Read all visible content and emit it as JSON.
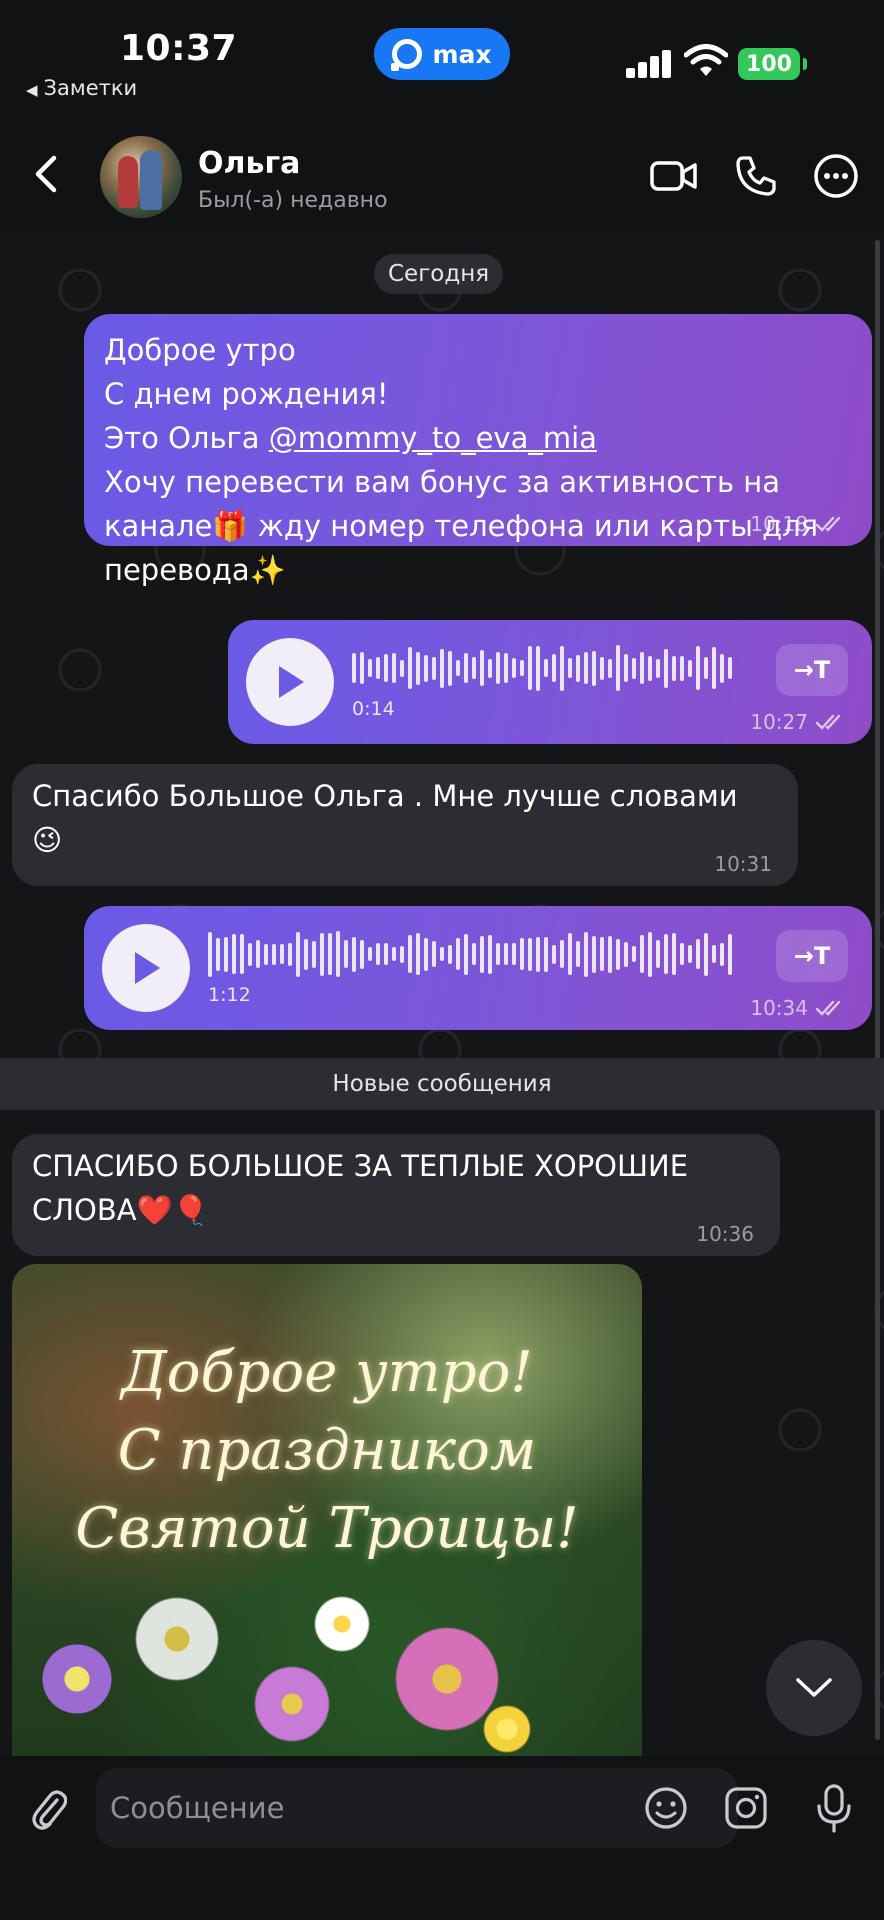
{
  "status_bar": {
    "time": "10:37",
    "back_app": "Заметки",
    "max_label": "max",
    "battery": "100"
  },
  "header": {
    "name": "Ольга",
    "status": "Был(-а) недавно"
  },
  "chat": {
    "date_separator": "Сегодня",
    "new_messages_label": "Новые сообщения",
    "messages": [
      {
        "direction": "outgoing",
        "lines": [
          "Доброе утро",
          "С днем рождения!",
          "Это Ольга "
        ],
        "mention": "@mommy_to_eva_mia",
        "line4": "Хочу перевести вам бонус за активность на",
        "line5": "канале🎁 жду номер телефона или карты для",
        "line6": "перевода✨",
        "time": "10:18"
      },
      {
        "direction": "outgoing",
        "type": "voice",
        "duration": "0:14",
        "time": "10:27",
        "to_text": "→T"
      },
      {
        "direction": "incoming",
        "line1": "Спасибо Большое Ольга . Мне лучше словами",
        "line2": "😉",
        "time": "10:31"
      },
      {
        "direction": "outgoing",
        "type": "voice",
        "duration": "1:12",
        "time": "10:34",
        "to_text": "→T"
      },
      {
        "direction": "incoming",
        "line1": "СПАСИБО БОЛЬШОЕ ЗА ТЕПЛЫЕ ХОРОШИЕ",
        "line2": "СЛОВА❤️🎈",
        "time": "10:36"
      },
      {
        "direction": "incoming",
        "type": "image",
        "overlay_lines": [
          "Доброе утро!",
          "С праздником",
          "Святой Троицы!"
        ]
      }
    ]
  },
  "composer": {
    "placeholder": "Сообщение"
  },
  "colors": {
    "outgoing_bubble_start": "#6a5ae6",
    "outgoing_bubble_end": "#8f4cc8",
    "incoming_bubble": "#2b2d33",
    "max_brand": "#1877f2",
    "battery": "#34c759"
  }
}
